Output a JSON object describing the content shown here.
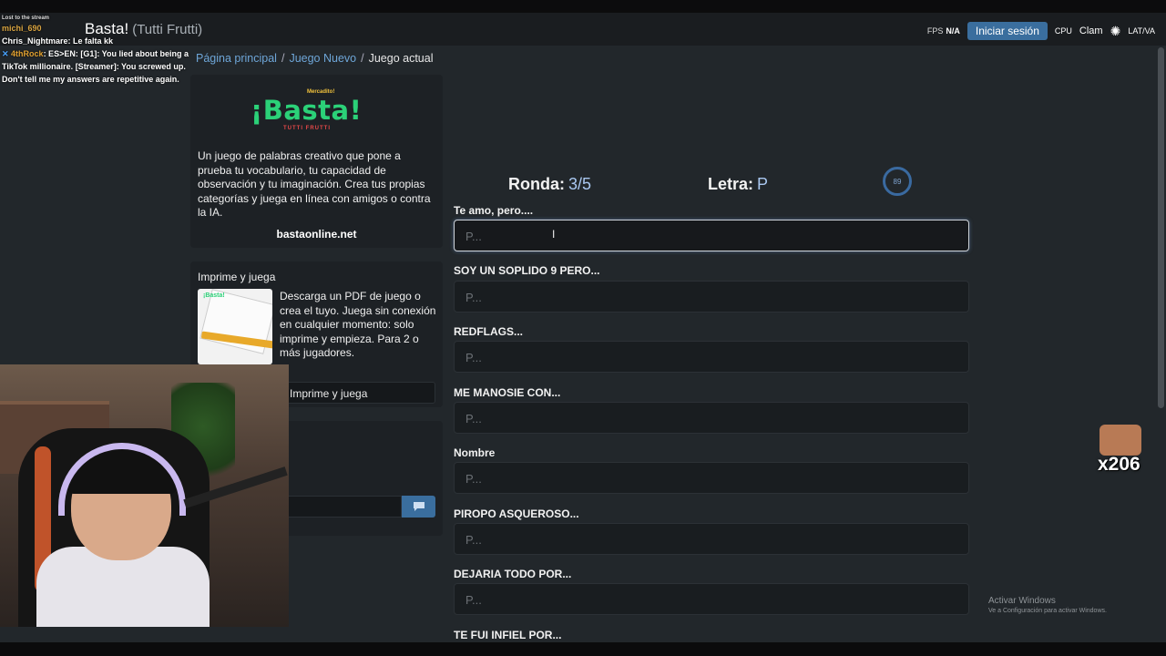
{
  "app": {
    "title": "Basta!",
    "subtitle": "(Tutti Frutti)"
  },
  "navbar": {
    "fps_label": "FPS",
    "fps_value": "N/A",
    "login_label": "Iniciar sesión",
    "cpu_label": "CPU",
    "rec_label": "Clam",
    "lang_label": "LAT/VA"
  },
  "chat": {
    "top_label": "Lost to the stream",
    "line1_user": "michi_690",
    "line2_user": "Chris_Nightmare",
    "line2_msg": ": Le falta kk",
    "line3_user": "4thRock",
    "line3_msg": ": ES>EN: [G1]: You lied about being a TikTok millionaire. [Streamer]: You screwed up. Don't tell me my answers are repetitive again."
  },
  "breadcrumb": {
    "home": "Página principal",
    "sep": "/",
    "new_game": "Juego Nuevo",
    "current": "Juego actual"
  },
  "promo": {
    "logo_small": "Mercadito!",
    "logo_main": "¡Basta!",
    "logo_sub": "TUTTI FRUTTI",
    "description": "Un juego de palabras creativo que pone a prueba tu vocabulario, tu capacidad de observación y tu imaginación. Crea tus propias categorías y juega en línea con amigos o contra la IA.",
    "site": "bastaonline.net"
  },
  "print": {
    "title": "Imprime y juega",
    "thumb_tag": "¡Basta!",
    "text": "Descarga un PDF de juego o crea el tuyo. Juega sin conexión en cualquier momento: solo imprime y empieza. Para 2 o más jugadores.",
    "button": "Imprime y juega"
  },
  "game": {
    "round_label": "Ronda:",
    "round_value": "3/5",
    "letter_label": "Letra:",
    "letter_value": "P",
    "timer_value": "89",
    "placeholder": "P...",
    "categories": [
      "Te amo, pero....",
      "SOY UN SOPLIDO 9 PERO...",
      "REDFLAGS...",
      "ME MANOSIE CON...",
      "Nombre",
      "PIROPO ASQUEROSO...",
      "DEJARIA TODO POR...",
      "TE FUI INFIEL POR..."
    ]
  },
  "overlay": {
    "emote_count": "x206",
    "activate_title": "Activar Windows",
    "activate_sub": "Ve a Configuración para activar Windows."
  },
  "colors": {
    "background": "#22272b",
    "accent": "#3a6e9e",
    "link": "#6ea6d8",
    "logo_green": "#2bd178"
  }
}
